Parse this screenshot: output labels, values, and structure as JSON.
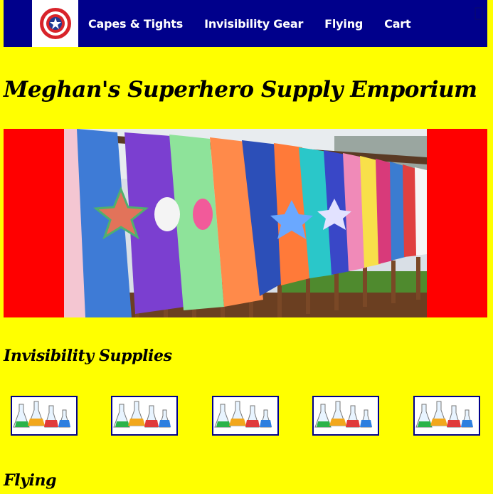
{
  "nav": {
    "logo_icon": "captain-shield-icon",
    "links": [
      {
        "label": "Capes & Tights"
      },
      {
        "label": "Invisibility Gear"
      },
      {
        "label": "Flying"
      },
      {
        "label": "Cart"
      }
    ]
  },
  "header": {
    "title": "Meghan's Superhero Supply Emporium"
  },
  "banner": {
    "image": "colorful-capes-on-fence-photo"
  },
  "sections": [
    {
      "heading": "Invisibility Supplies",
      "products": [
        {
          "image": "chemistry-flasks-photo"
        },
        {
          "image": "chemistry-flasks-photo"
        },
        {
          "image": "chemistry-flasks-photo"
        },
        {
          "image": "chemistry-flasks-photo"
        },
        {
          "image": "chemistry-flasks-photo"
        }
      ]
    },
    {
      "heading": "Flying"
    }
  ],
  "colors": {
    "page_background": "#ffff00",
    "nav_background": "#00008b",
    "banner_background": "#ff0000",
    "thumb_border": "#00008b"
  }
}
